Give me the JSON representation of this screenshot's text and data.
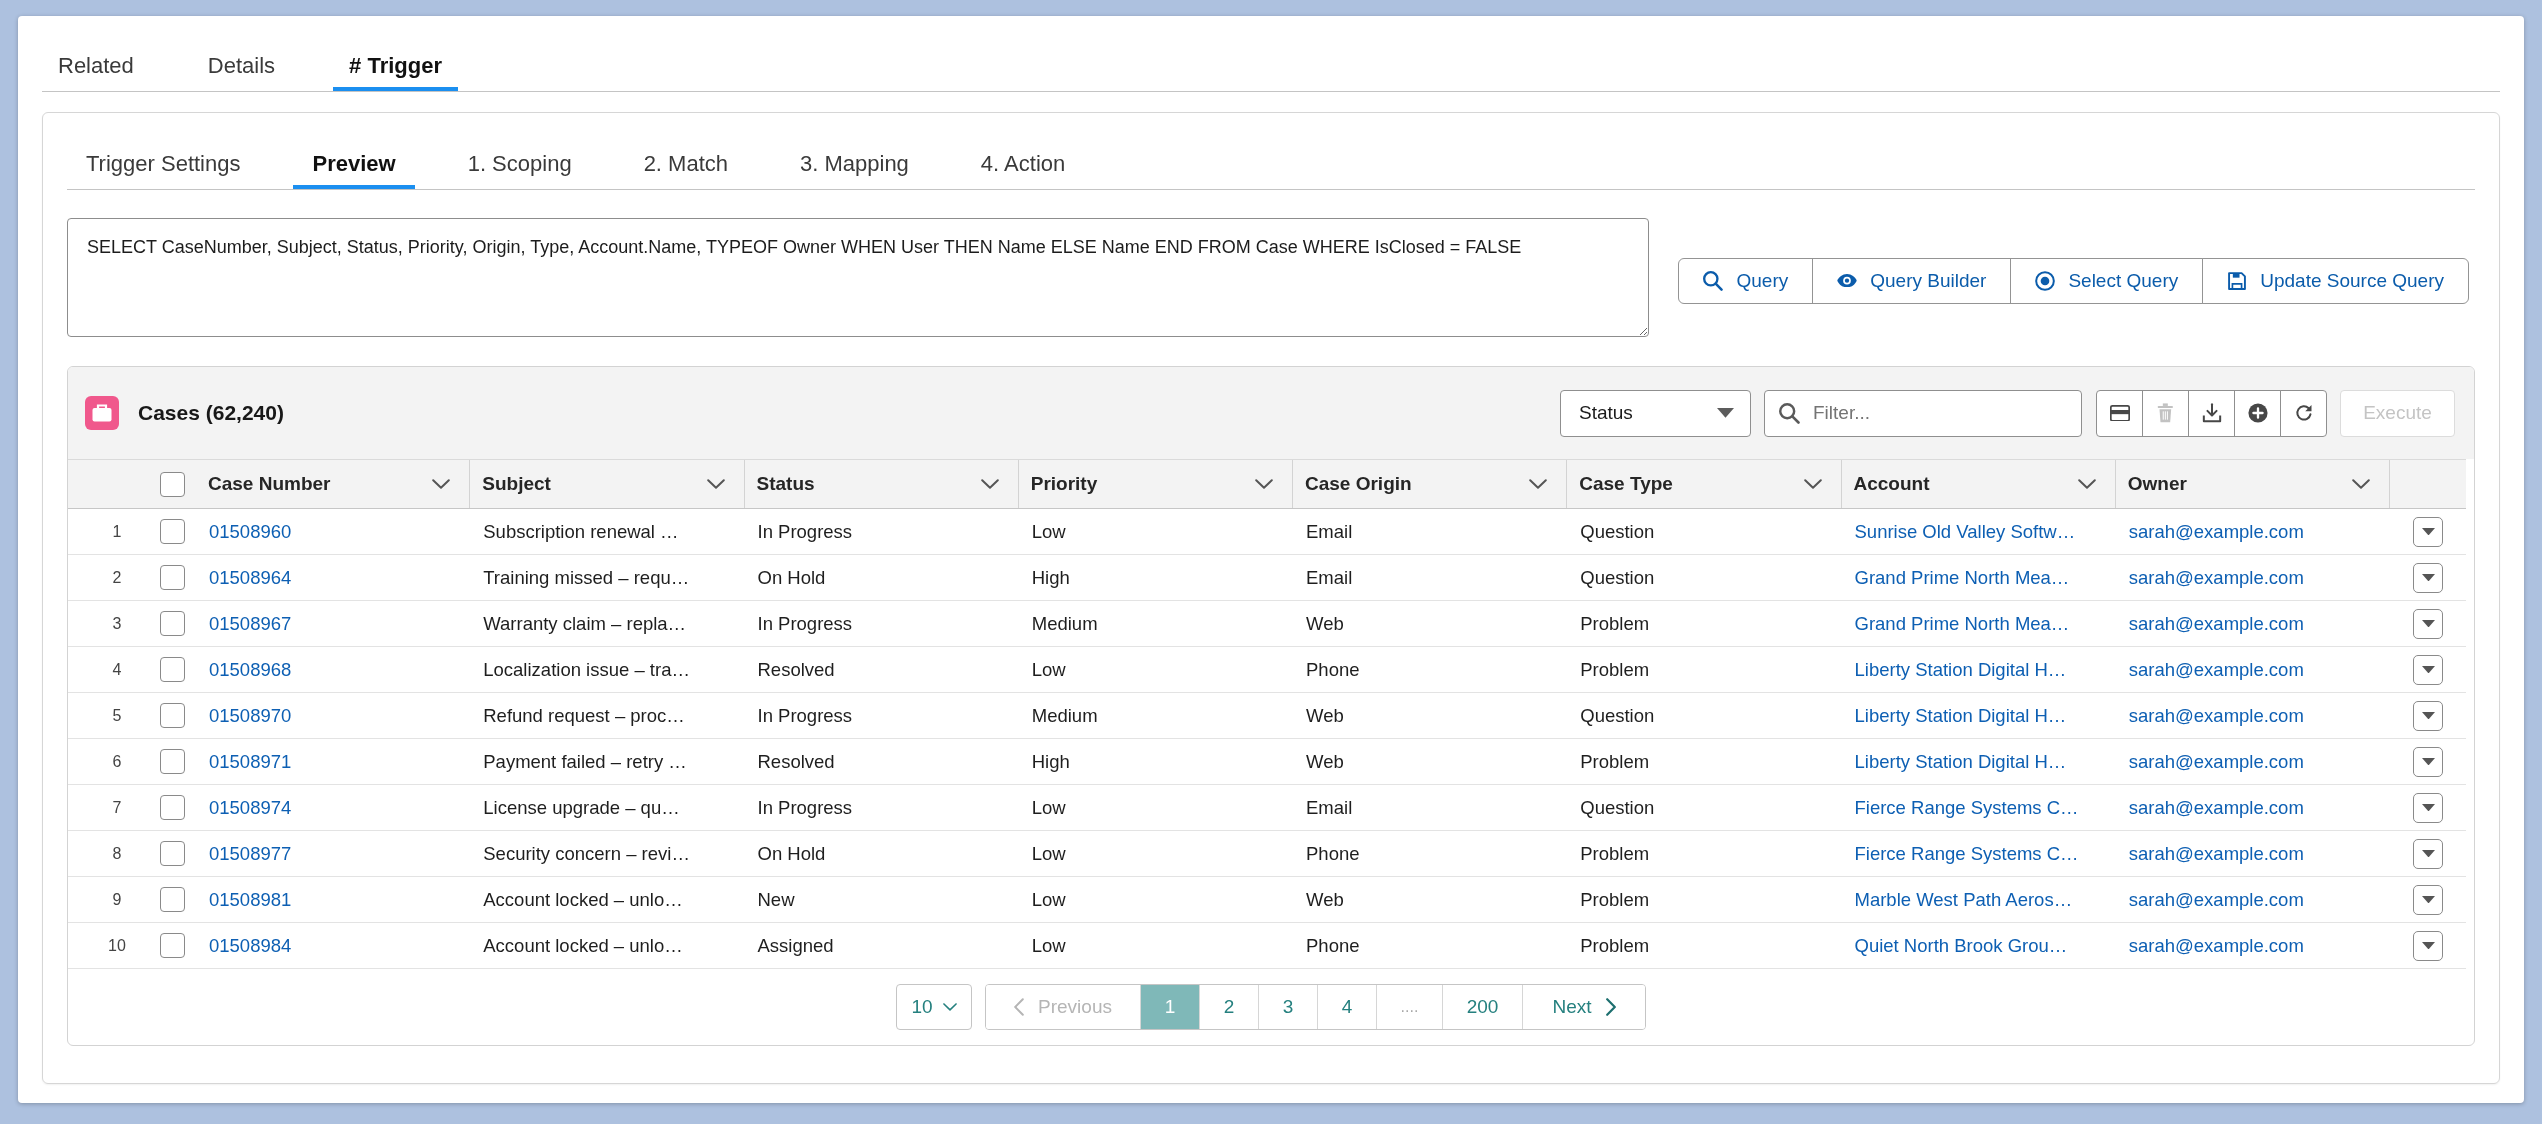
{
  "record_tabs": [
    {
      "label": "Related",
      "selected": false
    },
    {
      "label": "Details",
      "selected": false
    },
    {
      "label": "# Trigger",
      "selected": true
    }
  ],
  "sub_tabs": [
    {
      "label": "Trigger Settings",
      "selected": false
    },
    {
      "label": "Preview",
      "selected": true
    },
    {
      "label": "1. Scoping",
      "selected": false
    },
    {
      "label": "2. Match",
      "selected": false
    },
    {
      "label": "3. Mapping",
      "selected": false
    },
    {
      "label": "4. Action",
      "selected": false
    }
  ],
  "query": {
    "value": "SELECT CaseNumber, Subject, Status, Priority, Origin, Type, Account.Name, TYPEOF Owner WHEN User THEN Name ELSE Name END FROM Case WHERE IsClosed = FALSE"
  },
  "query_buttons": [
    {
      "label": "Query",
      "kind": "query"
    },
    {
      "label": "Query Builder",
      "kind": "builder"
    },
    {
      "label": "Select Query",
      "kind": "select"
    },
    {
      "label": "Update Source Query",
      "kind": "save"
    }
  ],
  "cases": {
    "title": "Cases (62,240)",
    "status_filter": {
      "value": "Status"
    },
    "filter": {
      "placeholder": "Filter..."
    },
    "tool_buttons": [
      {
        "kind": "layout",
        "disabled": false
      },
      {
        "kind": "delete",
        "disabled": true
      },
      {
        "kind": "download",
        "disabled": false
      },
      {
        "kind": "add",
        "disabled": false
      },
      {
        "kind": "refresh",
        "disabled": false
      }
    ],
    "execute": {
      "label": "Execute",
      "disabled": true
    },
    "select_all": {
      "checked": false
    },
    "columns": [
      {
        "label": "Case Number",
        "kind": "link"
      },
      {
        "label": "Subject",
        "kind": "text"
      },
      {
        "label": "Status",
        "kind": "text"
      },
      {
        "label": "Priority",
        "kind": "text"
      },
      {
        "label": "Case Origin",
        "kind": "text"
      },
      {
        "label": "Case Type",
        "kind": "text"
      },
      {
        "label": "Account",
        "kind": "link"
      },
      {
        "label": "Owner",
        "kind": "link"
      }
    ],
    "rows": [
      {
        "number": "1",
        "checked": false,
        "cells": [
          "01508960",
          "Subscription renewal …",
          "In Progress",
          "Low",
          "Email",
          "Question",
          "Sunrise Old Valley Softw…",
          "sarah@example.com"
        ]
      },
      {
        "number": "2",
        "checked": false,
        "cells": [
          "01508964",
          "Training missed – requ…",
          "On Hold",
          "High",
          "Email",
          "Question",
          "Grand Prime North Mea…",
          "sarah@example.com"
        ]
      },
      {
        "number": "3",
        "checked": false,
        "cells": [
          "01508967",
          "Warranty claim – repla…",
          "In Progress",
          "Medium",
          "Web",
          "Problem",
          "Grand Prime North Mea…",
          "sarah@example.com"
        ]
      },
      {
        "number": "4",
        "checked": false,
        "cells": [
          "01508968",
          "Localization issue – tra…",
          "Resolved",
          "Low",
          "Phone",
          "Problem",
          "Liberty Station Digital H…",
          "sarah@example.com"
        ]
      },
      {
        "number": "5",
        "checked": false,
        "cells": [
          "01508970",
          "Refund request – proc…",
          "In Progress",
          "Medium",
          "Web",
          "Question",
          "Liberty Station Digital H…",
          "sarah@example.com"
        ]
      },
      {
        "number": "6",
        "checked": false,
        "cells": [
          "01508971",
          "Payment failed – retry …",
          "Resolved",
          "High",
          "Web",
          "Problem",
          "Liberty Station Digital H…",
          "sarah@example.com"
        ]
      },
      {
        "number": "7",
        "checked": false,
        "cells": [
          "01508974",
          "License upgrade – qu…",
          "In Progress",
          "Low",
          "Email",
          "Question",
          "Fierce Range Systems C…",
          "sarah@example.com"
        ]
      },
      {
        "number": "8",
        "checked": false,
        "cells": [
          "01508977",
          "Security concern – revi…",
          "On Hold",
          "Low",
          "Phone",
          "Problem",
          "Fierce Range Systems C…",
          "sarah@example.com"
        ]
      },
      {
        "number": "9",
        "checked": false,
        "cells": [
          "01508981",
          "Account locked – unlo…",
          "New",
          "Low",
          "Web",
          "Problem",
          "Marble West Path Aeros…",
          "sarah@example.com"
        ]
      },
      {
        "number": "10",
        "checked": false,
        "cells": [
          "01508984",
          "Account locked – unlo…",
          "Assigned",
          "Low",
          "Phone",
          "Problem",
          "Quiet North Brook Grou…",
          "sarah@example.com"
        ]
      }
    ],
    "pagination": {
      "page_size": "10",
      "previous": {
        "label": "Previous",
        "disabled": true
      },
      "pages": [
        {
          "label": "1",
          "kind": "page",
          "selected": true
        },
        {
          "label": "2",
          "kind": "page",
          "selected": false
        },
        {
          "label": "3",
          "kind": "page",
          "selected": false
        },
        {
          "label": "4",
          "kind": "page",
          "selected": false
        },
        {
          "label": "....",
          "kind": "gap",
          "selected": false
        },
        {
          "label": "200",
          "kind": "page",
          "selected": false
        }
      ],
      "next": {
        "label": "Next",
        "disabled": false
      }
    }
  }
}
